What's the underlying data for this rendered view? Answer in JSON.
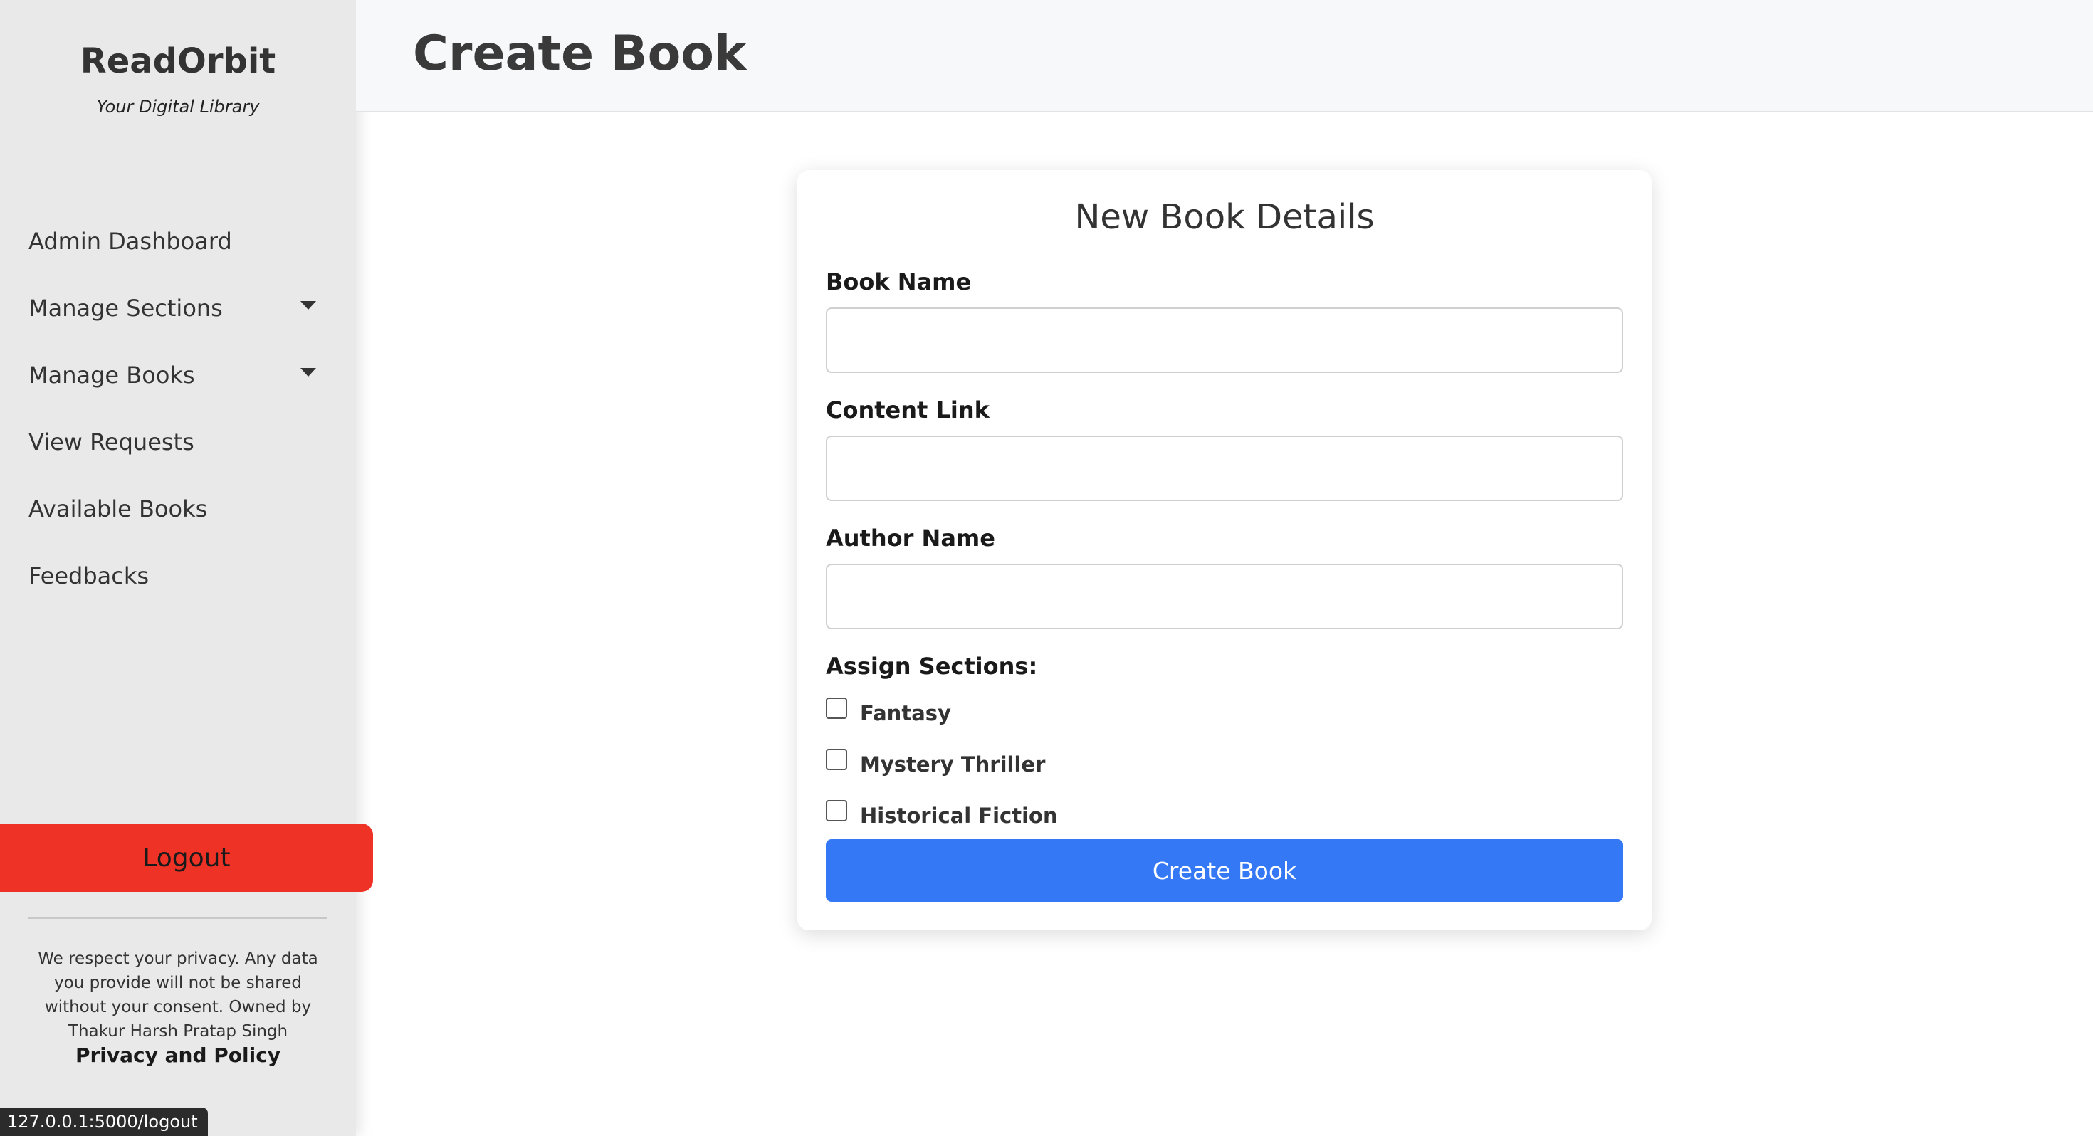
{
  "sidebar": {
    "brand": "ReadOrbit",
    "tagline": "Your Digital Library",
    "nav": [
      {
        "label": "Admin Dashboard",
        "has_dropdown": false
      },
      {
        "label": "Manage Sections",
        "has_dropdown": true
      },
      {
        "label": "Manage Books",
        "has_dropdown": true
      },
      {
        "label": "View Requests",
        "has_dropdown": false
      },
      {
        "label": "Available Books",
        "has_dropdown": false
      },
      {
        "label": "Feedbacks",
        "has_dropdown": false
      }
    ],
    "logout_label": "Logout",
    "privacy_text": "We respect your privacy. Any data you provide will not be shared without your consent. Owned by Thakur Harsh Pratap Singh",
    "privacy_link": "Privacy and Policy"
  },
  "status_bar": {
    "url": "127.0.0.1:5000/logout"
  },
  "header": {
    "title": "Create Book"
  },
  "form": {
    "title": "New Book Details",
    "fields": [
      {
        "label": "Book Name",
        "value": "",
        "placeholder": ""
      },
      {
        "label": "Content Link",
        "value": "",
        "placeholder": ""
      },
      {
        "label": "Author Name",
        "value": "",
        "placeholder": ""
      }
    ],
    "sections_label": "Assign Sections:",
    "sections": [
      {
        "label": "Fantasy",
        "checked": false
      },
      {
        "label": "Mystery Thriller",
        "checked": false
      },
      {
        "label": "Historical Fiction",
        "checked": false
      }
    ],
    "submit_label": "Create Book"
  },
  "colors": {
    "sidebar_bg": "#e9e9ea",
    "logout_bg": "#ee3326",
    "primary": "#3578f6",
    "header_bg": "#f7f8f9"
  }
}
